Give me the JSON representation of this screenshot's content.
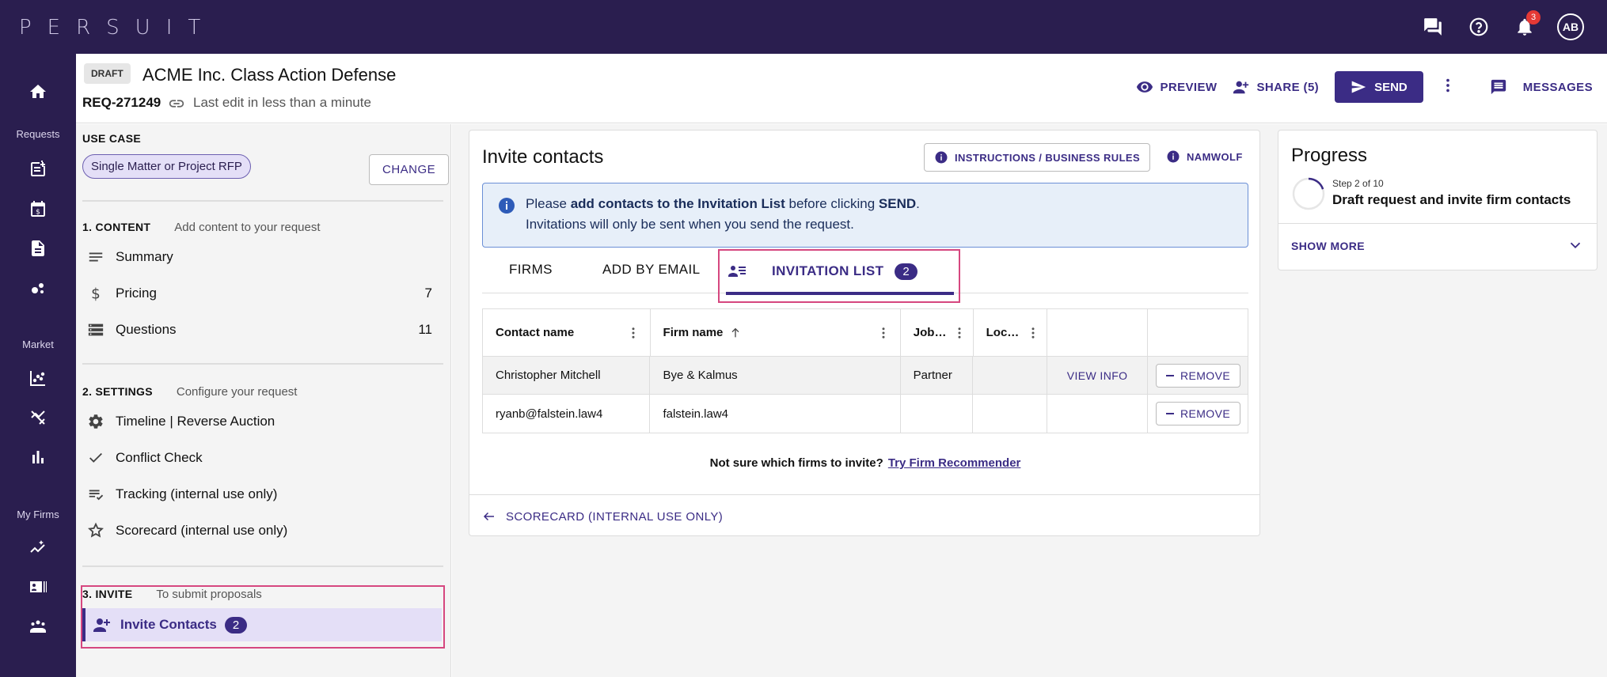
{
  "topbar": {
    "logo": "PERSUIT",
    "notification_count": "3",
    "avatar_initials": "AB"
  },
  "leftnav": {
    "sections": [
      {
        "label": "Requests"
      },
      {
        "label": "Market"
      },
      {
        "label": "My Firms"
      }
    ]
  },
  "header": {
    "draft_label": "DRAFT",
    "title": "ACME Inc. Class Action Defense",
    "req_id": "REQ-271249",
    "last_edit": "Last edit in less than a minute",
    "preview_label": "PREVIEW",
    "share_label": "SHARE (5)",
    "send_label": "SEND",
    "messages_label": "MESSAGES"
  },
  "leftpanel": {
    "use_case_label": "USE CASE",
    "use_case_value": "Single Matter or Project RFP",
    "change_label": "CHANGE",
    "content": {
      "heading": "1. CONTENT",
      "subtitle": "Add content to your request",
      "items": [
        {
          "label": "Summary",
          "count": ""
        },
        {
          "label": "Pricing",
          "count": "7"
        },
        {
          "label": "Questions",
          "count": "11"
        }
      ]
    },
    "settings": {
      "heading": "2. SETTINGS",
      "subtitle": "Configure your request",
      "items": [
        {
          "label": "Timeline | Reverse Auction"
        },
        {
          "label": "Conflict Check"
        },
        {
          "label": "Tracking (internal use only)"
        },
        {
          "label": "Scorecard (internal use only)"
        }
      ]
    },
    "invite": {
      "heading": "3. INVITE",
      "subtitle": "To submit proposals",
      "item_label": "Invite Contacts",
      "item_count": "2"
    }
  },
  "main": {
    "title": "Invite contacts",
    "instructions_label": "INSTRUCTIONS / BUSINESS RULES",
    "namwolf_label": "NAMWOLF",
    "banner": {
      "pre": "Please ",
      "bold1": "add contacts to the Invitation List",
      "mid": " before clicking ",
      "bold2": "SEND",
      "end": ".",
      "line2": "Invitations will only be sent when you send the request."
    },
    "tabs": [
      {
        "label": "FIRMS"
      },
      {
        "label": "ADD BY EMAIL"
      },
      {
        "label": "INVITATION LIST",
        "count": "2"
      }
    ],
    "table": {
      "headers": [
        "Contact name",
        "Firm name",
        "Job…",
        "Loc…"
      ],
      "rows": [
        {
          "contact": "Christopher Mitchell",
          "firm": "Bye & Kalmus",
          "job": "Partner",
          "loc": "",
          "view": "VIEW INFO",
          "remove": "REMOVE"
        },
        {
          "contact": "ryanb@falstein.law4",
          "firm": "falstein.law4",
          "job": "",
          "loc": "",
          "view": "",
          "remove": "REMOVE"
        }
      ]
    },
    "recommender_text": "Not sure which firms to invite?",
    "recommender_link": "Try Firm Recommender",
    "back_label": "SCORECARD (INTERNAL USE ONLY)"
  },
  "progress": {
    "title": "Progress",
    "step": "Step 2 of 10",
    "description": "Draft request and invite firm contacts",
    "show_more": "SHOW MORE",
    "fraction": 0.2
  },
  "colors": {
    "brand_dark": "#2a1e4f",
    "accent": "#3b2c85",
    "highlight_border": "#d6477f"
  }
}
